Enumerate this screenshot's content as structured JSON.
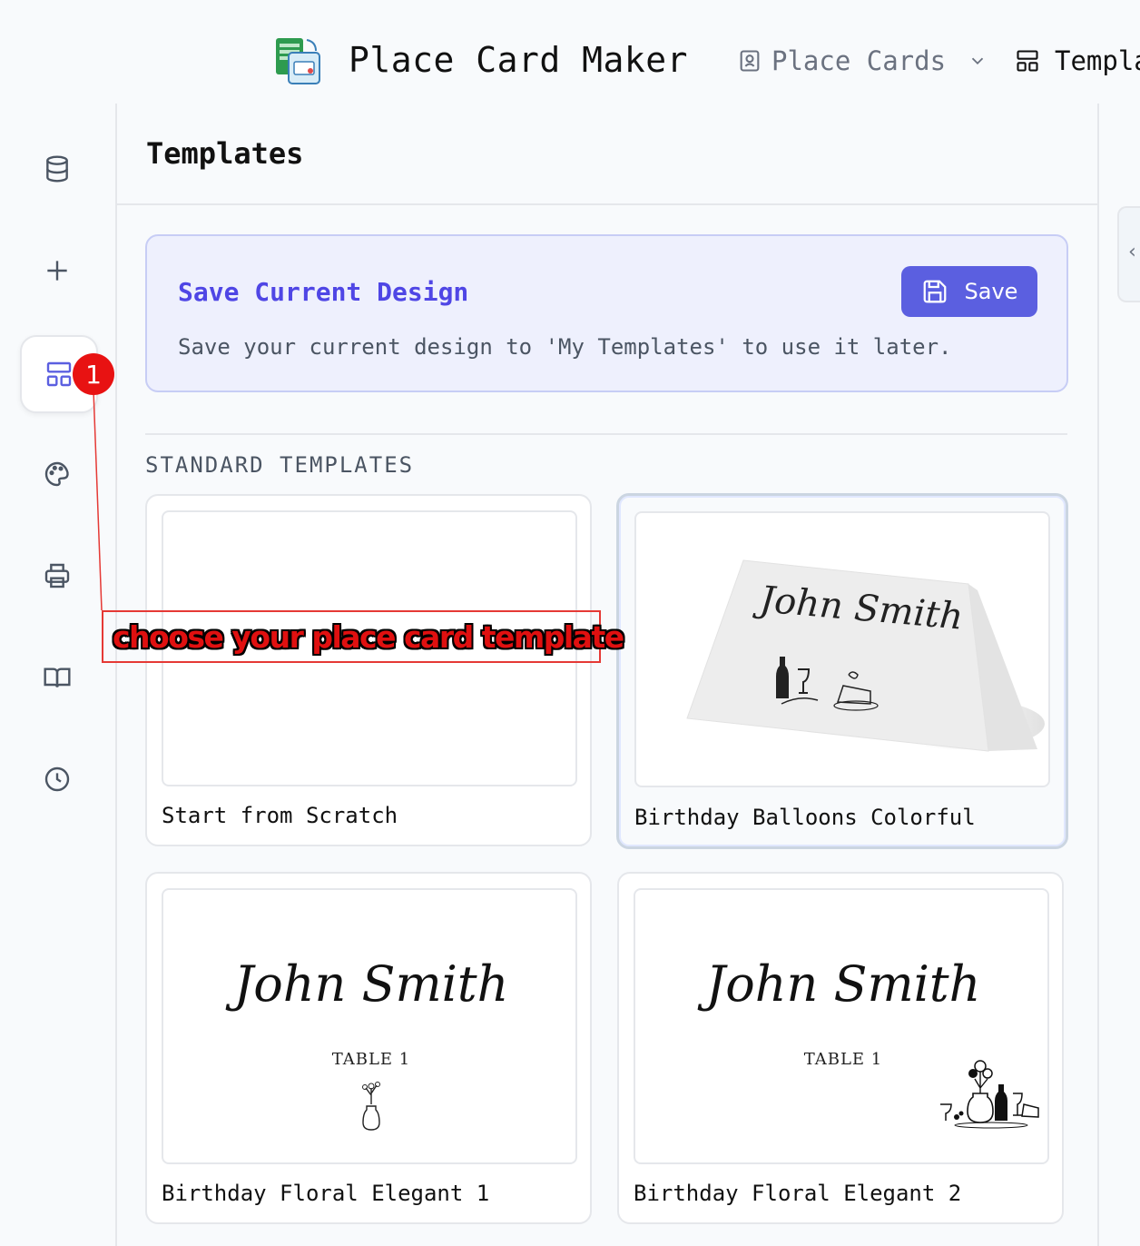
{
  "header": {
    "app_title": "Place Card Maker",
    "nav_place_cards": "Place Cards",
    "nav_templates": "Templa",
    "logo_icon": "spreadsheet-card-logo-icon"
  },
  "sidebar": {
    "items": [
      {
        "name": "database-icon",
        "active": false
      },
      {
        "name": "plus-icon",
        "active": false
      },
      {
        "name": "templates-layout-icon",
        "active": true
      },
      {
        "name": "palette-icon",
        "active": false
      },
      {
        "name": "printer-icon",
        "active": false
      },
      {
        "name": "book-icon",
        "active": false
      },
      {
        "name": "clock-icon",
        "active": false
      }
    ]
  },
  "panel": {
    "title": "Templates",
    "save_card": {
      "title": "Save Current Design",
      "description": "Save your current design to 'My Templates' to use it later.",
      "button_label": "Save"
    },
    "section_label": "STANDARD TEMPLATES",
    "templates": [
      {
        "name": "Start from Scratch",
        "selected": false
      },
      {
        "name": "Birthday Balloons Colorful",
        "selected": true,
        "preview_name": "John Smith"
      },
      {
        "name": "Birthday Floral Elegant 1",
        "selected": false,
        "preview_name": "John Smith",
        "preview_table": "TABLE 1"
      },
      {
        "name": "Birthday Floral Elegant 2",
        "selected": false,
        "preview_name": "John Smith",
        "preview_table": "TABLE 1"
      }
    ]
  },
  "annotation": {
    "badge": "1",
    "text": "choose your place card template",
    "color": "#e81212"
  },
  "colors": {
    "accent": "#5b5fe0",
    "accent_text": "#4f46e5",
    "save_card_bg": "#eef0fd"
  }
}
